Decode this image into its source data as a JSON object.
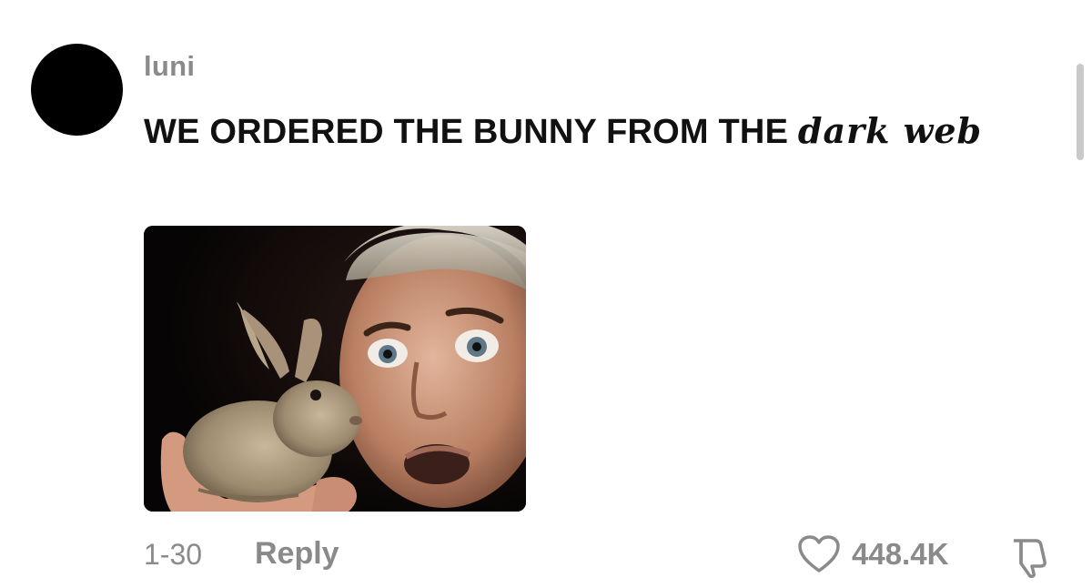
{
  "comment": {
    "username": "luni",
    "text_main": "WE ORDERED THE BUNNY FROM THE ",
    "text_gothic": "dark web",
    "date": "1-30",
    "reply_label": "Reply",
    "like_count": "448.4K"
  },
  "icons": {
    "like": "heart-icon",
    "dislike": "thumbs-down-icon"
  },
  "colors": {
    "muted_text": "#8a8a8a",
    "main_text": "#111111",
    "avatar": "#000000"
  }
}
